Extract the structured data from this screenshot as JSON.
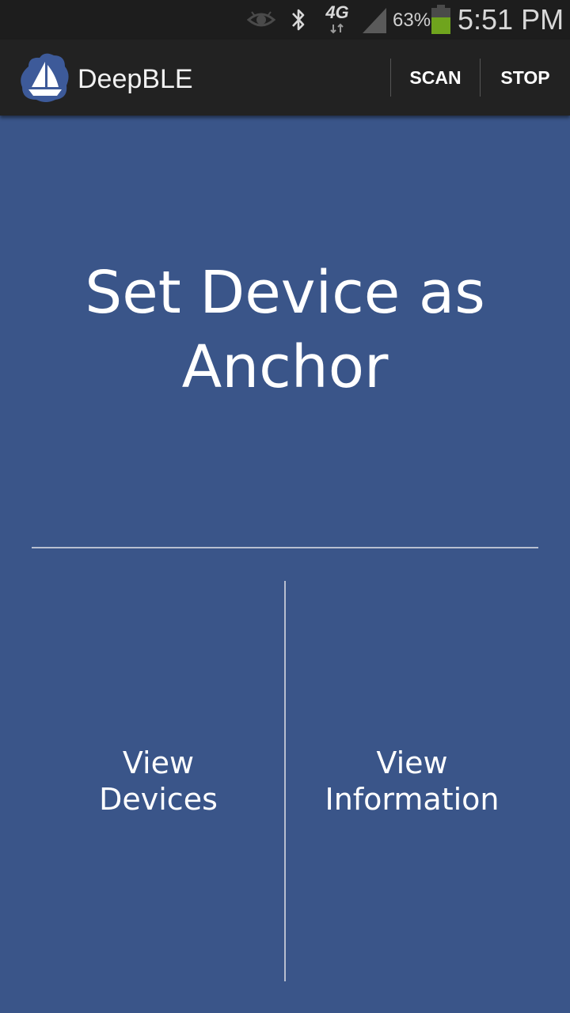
{
  "status_bar": {
    "icons": [
      "eye-icon",
      "bluetooth-icon",
      "4g-icon",
      "signal-icon",
      "battery-icon"
    ],
    "network_label": "4G",
    "battery_percent": "63%",
    "time": "5:51 PM",
    "battery_fill_color": "#6fa41d"
  },
  "action_bar": {
    "app_icon": "sailboat-logo",
    "title": "DeepBLE",
    "scan_label": "SCAN",
    "stop_label": "STOP"
  },
  "main": {
    "anchor_line1": "Set Device as",
    "anchor_line2": "Anchor",
    "view_devices_line1": "View",
    "view_devices_line2": "Devices",
    "view_information_line1": "View",
    "view_information_line2": "Information"
  },
  "colors": {
    "background": "#3a5589",
    "action_bar": "#222222",
    "status_bar": "#1d1d1d",
    "divider": "#b8bfd0"
  }
}
